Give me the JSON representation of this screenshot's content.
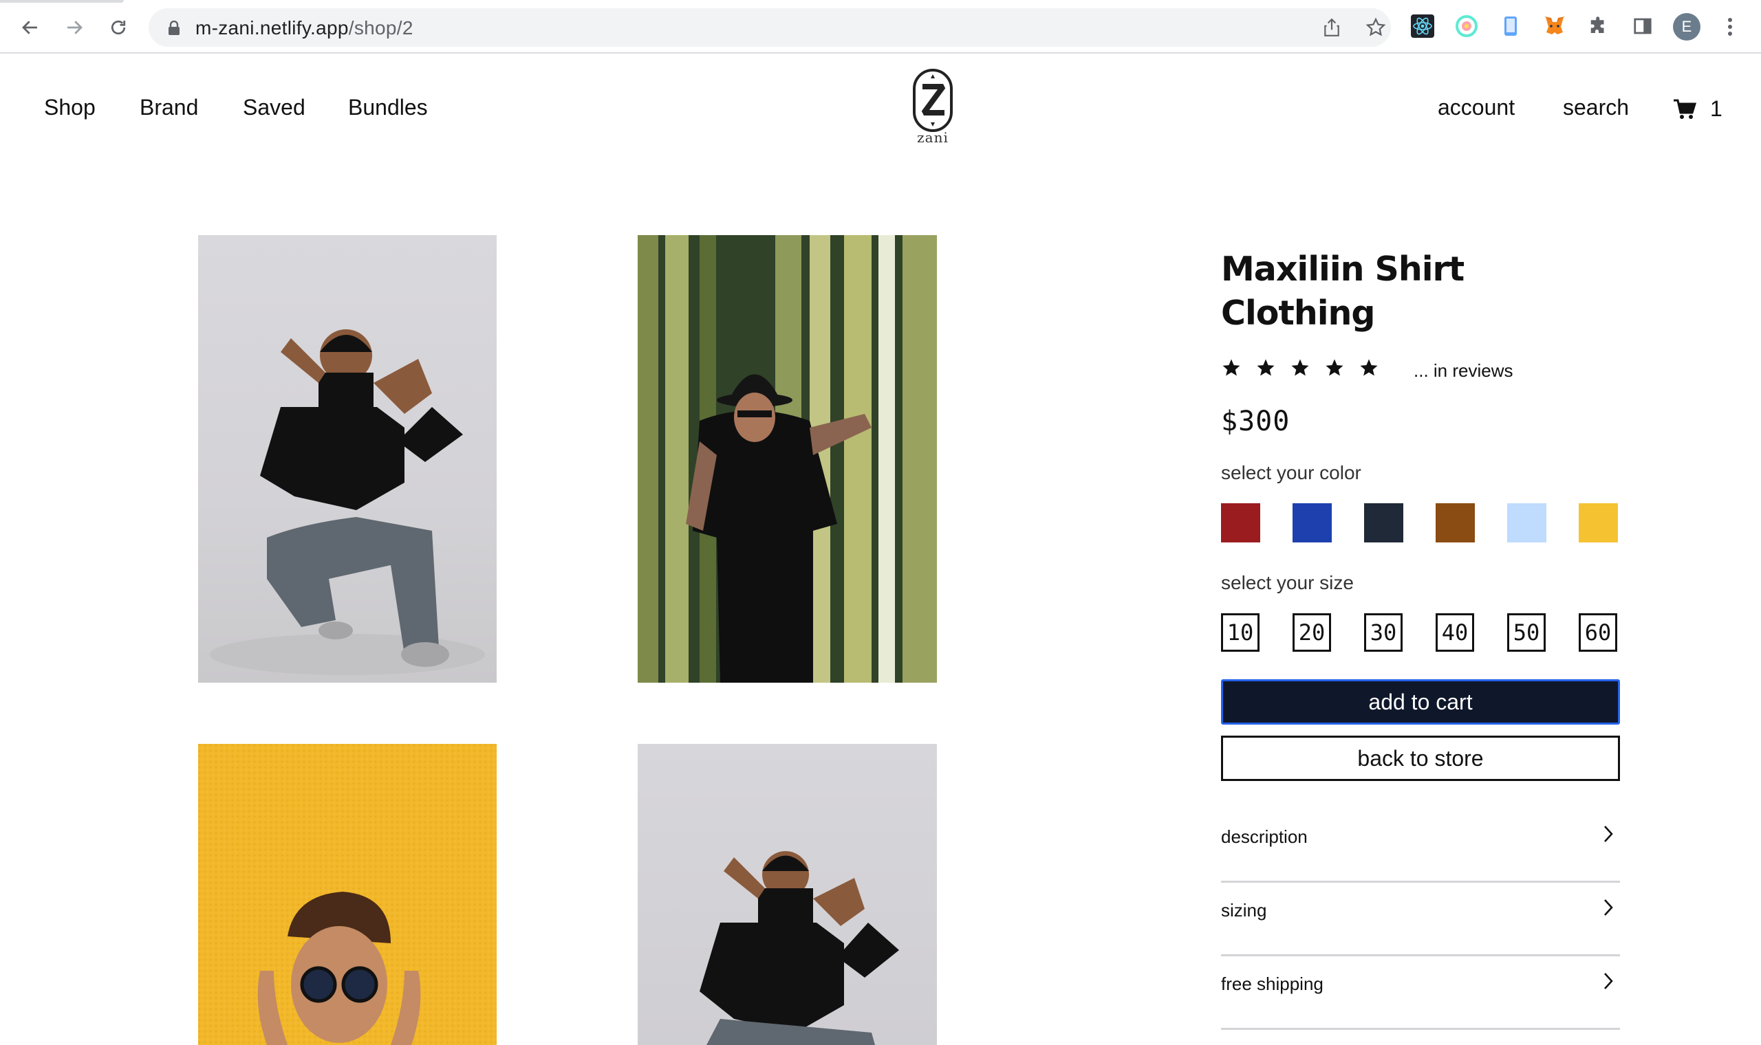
{
  "browser": {
    "url_host": "m-zani.netlify.app",
    "url_path": "/shop/2",
    "back_icon": "arrow-left-icon",
    "forward_icon": "arrow-right-icon",
    "reload_icon": "reload-icon",
    "profile_initial": "E"
  },
  "nav": {
    "links": [
      "Shop",
      "Brand",
      "Saved",
      "Bundles"
    ],
    "logo_text": "zani",
    "account": "account",
    "search": "search",
    "cart_count": "1"
  },
  "product": {
    "title_line1": "Maxiliin Shirt",
    "title_line2": "Clothing",
    "stars": 5,
    "reviews_text": "... in reviews",
    "price": "$300",
    "color_label": "select your color",
    "colors": [
      "#9b1c1f",
      "#1e40af",
      "#1f2937",
      "#8b4c13",
      "#bfdbfe",
      "#f5c332"
    ],
    "size_label": "select your size",
    "sizes": [
      "10",
      "20",
      "30",
      "40",
      "50",
      "60"
    ],
    "add_to_cart": "add to cart",
    "back_to_store": "back to store",
    "accordion": [
      "description",
      "sizing",
      "free shipping"
    ]
  }
}
